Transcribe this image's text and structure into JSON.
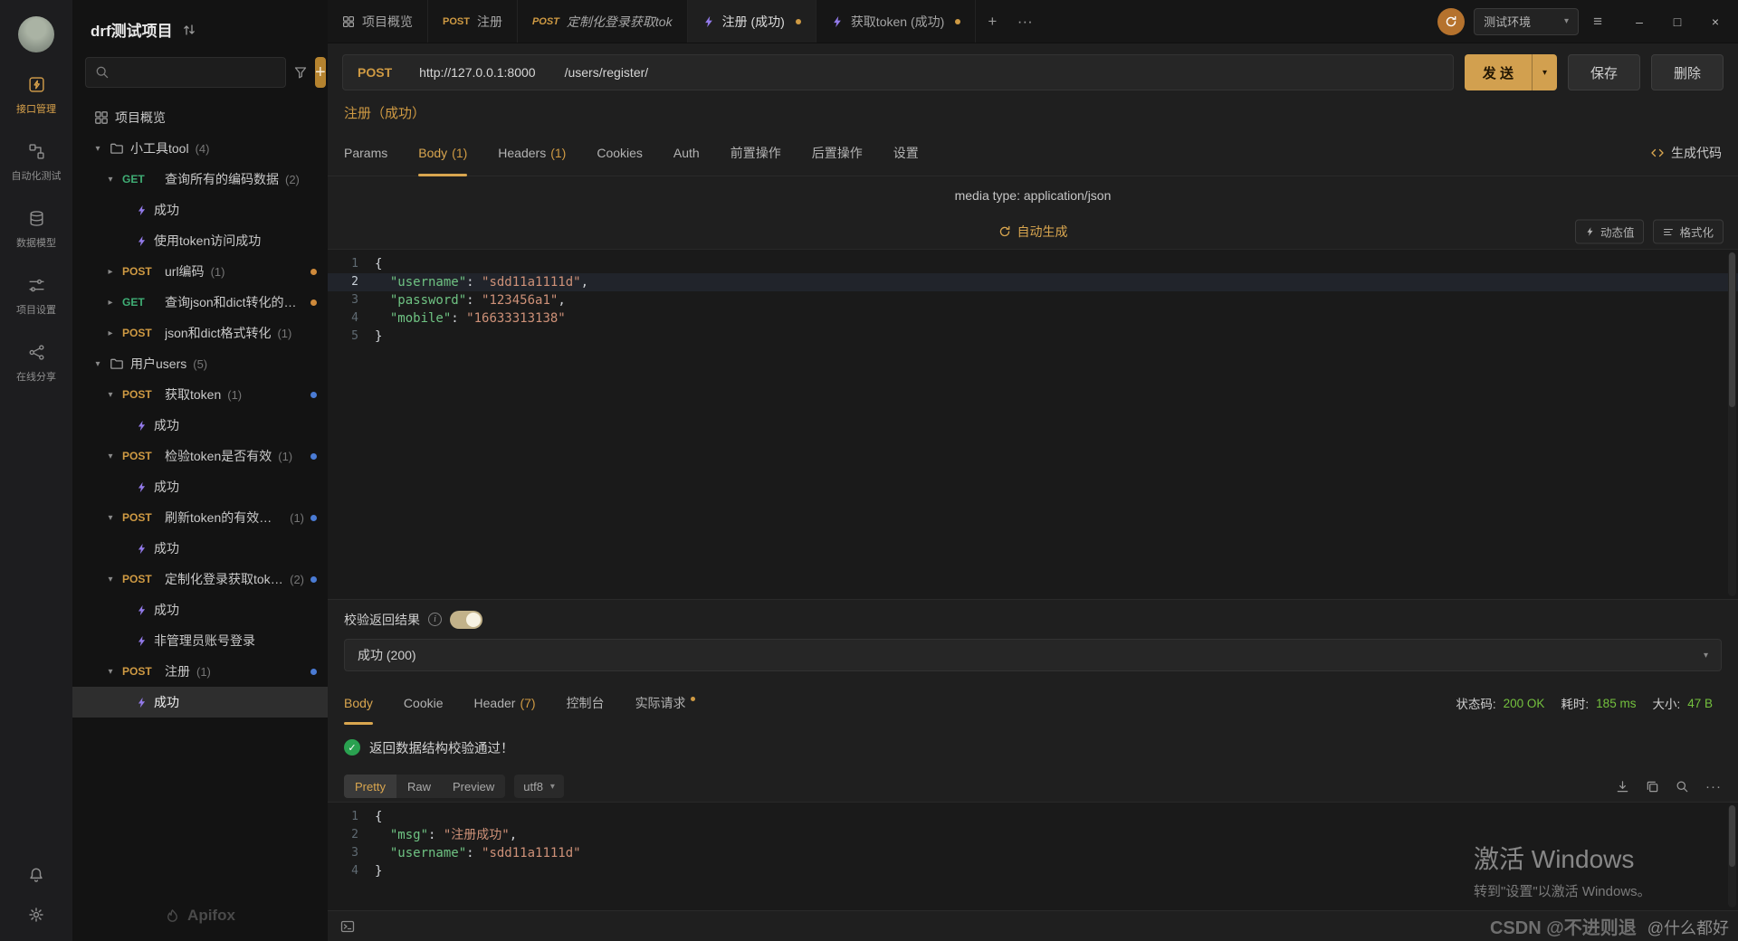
{
  "icons": {
    "plus": "+",
    "more_dots": "···",
    "menu": "≡",
    "minimize": "–",
    "maximize": "□",
    "close": "×",
    "chevron_down": "▾",
    "arrow_open": "▾",
    "arrow_closed": "▸",
    "info": "i",
    "check": "✓"
  },
  "colors": {
    "accent": "#d9a64f",
    "get": "#3fae75",
    "post": "#cf9a43",
    "success": "#74c13e",
    "bolt": "#937aea"
  },
  "rail": {
    "items": [
      {
        "id": "api",
        "icon": "api-manage",
        "label": "接口管理",
        "active": true
      },
      {
        "id": "auto",
        "icon": "automation-test",
        "label": "自动化测试",
        "active": false
      },
      {
        "id": "model",
        "icon": "data-model",
        "label": "数据模型",
        "active": false
      },
      {
        "id": "proj",
        "icon": "project-settings",
        "label": "项目设置",
        "active": false
      },
      {
        "id": "share",
        "icon": "share",
        "label": "在线分享",
        "active": false
      }
    ]
  },
  "sidebar": {
    "project": "drf测试项目",
    "search_placeholder": "",
    "logo": "Apifox",
    "tree": [
      {
        "type": "overview",
        "label": "项目概览",
        "count": ""
      },
      {
        "type": "folder",
        "label": "小工具tool",
        "count": "(4)",
        "expanded": true
      },
      {
        "type": "request",
        "method": "GET",
        "label": "查询所有的编码数据",
        "count": "(2)",
        "expanded": true,
        "dot": ""
      },
      {
        "type": "case",
        "label": "成功",
        "selected": false
      },
      {
        "type": "case",
        "label": "使用token访问成功",
        "selected": false
      },
      {
        "type": "request",
        "method": "POST",
        "label": "url编码",
        "count": "(1)",
        "expanded": false,
        "dot": "orange"
      },
      {
        "type": "request",
        "method": "GET",
        "label": "查询json和dict转化的全部...",
        "count": "",
        "expanded": false,
        "dot": "orange"
      },
      {
        "type": "request",
        "method": "POST",
        "label": "json和dict格式转化",
        "count": "(1)",
        "expanded": false,
        "dot": ""
      },
      {
        "type": "folder",
        "label": "用户users",
        "count": "(5)",
        "expanded": true
      },
      {
        "type": "request",
        "method": "POST",
        "label": "获取token",
        "count": "(1)",
        "expanded": true,
        "dot": "blue"
      },
      {
        "type": "case",
        "label": "成功",
        "selected": false
      },
      {
        "type": "request",
        "method": "POST",
        "label": "检验token是否有效",
        "count": "(1)",
        "expanded": true,
        "dot": "blue"
      },
      {
        "type": "case",
        "label": "成功",
        "selected": false
      },
      {
        "type": "request",
        "method": "POST",
        "label": "刷新token的有效时间",
        "count": "(1)",
        "expanded": true,
        "dot": "blue"
      },
      {
        "type": "case",
        "label": "成功",
        "selected": false
      },
      {
        "type": "request",
        "method": "POST",
        "label": "定制化登录获取token",
        "count": "(2)",
        "expanded": true,
        "dot": "blue"
      },
      {
        "type": "case",
        "label": "成功",
        "selected": false
      },
      {
        "type": "case",
        "label": "非管理员账号登录",
        "selected": false
      },
      {
        "type": "request",
        "method": "POST",
        "label": "注册",
        "count": "(1)",
        "expanded": true,
        "dot": "blue"
      },
      {
        "type": "case",
        "label": "成功",
        "selected": true
      }
    ]
  },
  "tabbar": {
    "tabs": [
      {
        "kind": "grid",
        "label": "项目概览",
        "active": false,
        "dot": false,
        "italic": false
      },
      {
        "kind": "method",
        "method": "POST",
        "label": "注册",
        "active": false,
        "dot": false,
        "italic": false
      },
      {
        "kind": "method",
        "method": "POST",
        "label": "定制化登录获取tok",
        "active": false,
        "dot": false,
        "italic": true
      },
      {
        "kind": "bolt",
        "label": "注册 (成功)",
        "active": true,
        "dot": true,
        "italic": false
      },
      {
        "kind": "bolt",
        "label": "获取token (成功)",
        "active": false,
        "dot": true,
        "italic": false
      }
    ],
    "env": "测试环境"
  },
  "request": {
    "method": "POST",
    "base_url": "http://127.0.0.1:8000",
    "path": "/users/register/",
    "send_label": "发 送",
    "save_label": "保存",
    "delete_label": "删除",
    "case_name": "注册（成功）",
    "tabs": [
      {
        "label": "Params",
        "count": "",
        "active": false,
        "dot": false
      },
      {
        "label": "Body",
        "count": "(1)",
        "active": true,
        "dot": false
      },
      {
        "label": "Headers",
        "count": "(1)",
        "active": false,
        "dot": false
      },
      {
        "label": "Cookies",
        "count": "",
        "active": false,
        "dot": false
      },
      {
        "label": "Auth",
        "count": "",
        "active": false,
        "dot": false
      },
      {
        "label": "前置操作",
        "count": "",
        "active": false,
        "dot": false
      },
      {
        "label": "后置操作",
        "count": "",
        "active": false,
        "dot": false
      },
      {
        "label": "设置",
        "count": "",
        "active": false,
        "dot": false
      }
    ],
    "generate_code": "生成代码",
    "media_type": "media type: application/json",
    "auto_generate": "自动生成",
    "dynamic_value": "动态值",
    "format": "格式化",
    "code": [
      {
        "n": "1",
        "active": false,
        "seg": [
          {
            "t": "{",
            "c": "p"
          }
        ]
      },
      {
        "n": "2",
        "active": true,
        "seg": [
          {
            "t": "  ",
            "c": "p"
          },
          {
            "t": "\"username\"",
            "c": "k"
          },
          {
            "t": ": ",
            "c": "p"
          },
          {
            "t": "\"sdd11a1111d\"",
            "c": "s"
          },
          {
            "t": ",",
            "c": "p"
          }
        ]
      },
      {
        "n": "3",
        "active": false,
        "seg": [
          {
            "t": "  ",
            "c": "p"
          },
          {
            "t": "\"password\"",
            "c": "k"
          },
          {
            "t": ": ",
            "c": "p"
          },
          {
            "t": "\"123456a1\"",
            "c": "s"
          },
          {
            "t": ",",
            "c": "p"
          }
        ]
      },
      {
        "n": "4",
        "active": false,
        "seg": [
          {
            "t": "  ",
            "c": "p"
          },
          {
            "t": "\"mobile\"",
            "c": "k"
          },
          {
            "t": ": ",
            "c": "p"
          },
          {
            "t": "\"16633313138\"",
            "c": "s"
          }
        ]
      },
      {
        "n": "5",
        "active": false,
        "seg": [
          {
            "t": "}",
            "c": "p"
          }
        ]
      }
    ]
  },
  "validate": {
    "label": "校验返回结果",
    "case_value": "成功 (200)"
  },
  "response": {
    "tabs": [
      {
        "label": "Body",
        "count": "",
        "active": true,
        "dot": false
      },
      {
        "label": "Cookie",
        "count": "",
        "active": false,
        "dot": false
      },
      {
        "label": "Header",
        "count": "(7)",
        "active": false,
        "dot": false
      },
      {
        "label": "控制台",
        "count": "",
        "active": false,
        "dot": false
      },
      {
        "label": "实际请求",
        "count": "",
        "active": false,
        "dot": true
      }
    ],
    "status_label": "状态码:",
    "status_value": "200 OK",
    "time_label": "耗时:",
    "time_value": "185 ms",
    "size_label": "大小:",
    "size_value": "47 B",
    "check_message": "返回数据结构校验通过！",
    "views": [
      "Pretty",
      "Raw",
      "Preview"
    ],
    "active_view": "Pretty",
    "encoding": "utf8",
    "code": [
      {
        "n": "1",
        "active": false,
        "seg": [
          {
            "t": "{",
            "c": "p"
          }
        ]
      },
      {
        "n": "2",
        "active": false,
        "seg": [
          {
            "t": "  ",
            "c": "p"
          },
          {
            "t": "\"msg\"",
            "c": "k"
          },
          {
            "t": ": ",
            "c": "p"
          },
          {
            "t": "\"注册成功\"",
            "c": "s"
          },
          {
            "t": ",",
            "c": "p"
          }
        ]
      },
      {
        "n": "3",
        "active": false,
        "seg": [
          {
            "t": "  ",
            "c": "p"
          },
          {
            "t": "\"username\"",
            "c": "k"
          },
          {
            "t": ": ",
            "c": "p"
          },
          {
            "t": "\"sdd11a1111d\"",
            "c": "s"
          }
        ]
      },
      {
        "n": "4",
        "active": false,
        "seg": [
          {
            "t": "}",
            "c": "p"
          }
        ]
      }
    ]
  },
  "watermarks": {
    "win_title": "激活 Windows",
    "win_sub": "转到\"设置\"以激活 Windows。",
    "csdn": "CSDN @不进则退",
    "extra": "@什么都好"
  }
}
